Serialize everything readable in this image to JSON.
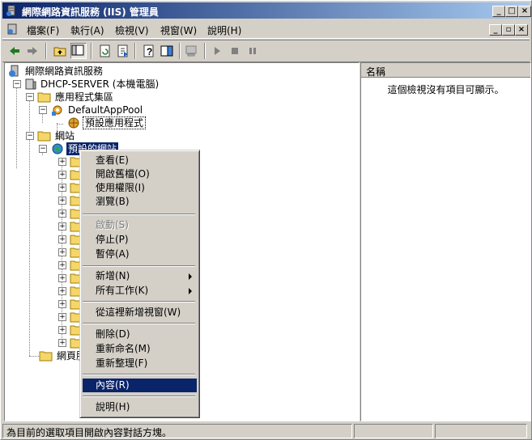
{
  "window": {
    "title": "網際網路資訊服務 (IIS) 管理員"
  },
  "menu": {
    "items": [
      "檔案(F)",
      "執行(A)",
      "檢視(V)",
      "視窗(W)",
      "說明(H)"
    ]
  },
  "tree": {
    "root": "網際網路資訊服務",
    "server": "DHCP-SERVER (本機電腦)",
    "app_pools": "應用程式集區",
    "default_pool": "DefaultAppPool",
    "default_app": "預設應用程式",
    "websites": "網站",
    "default_site": "預設的網站",
    "web_ext": "網頁服務延伸"
  },
  "rightpane": {
    "column_header": "名稱",
    "empty_message": "這個檢視沒有項目可顯示。"
  },
  "context_menu": {
    "items": [
      {
        "label": "查看(E)",
        "disabled": false
      },
      {
        "label": "開啟舊檔(O)",
        "disabled": false
      },
      {
        "label": "使用權限(I)",
        "disabled": false
      },
      {
        "label": "瀏覽(B)",
        "disabled": false
      },
      {
        "label": "啟動(S)",
        "disabled": true
      },
      {
        "label": "停止(P)",
        "disabled": false
      },
      {
        "label": "暫停(A)",
        "disabled": false
      },
      {
        "label": "新增(N)",
        "disabled": false,
        "submenu": true
      },
      {
        "label": "所有工作(K)",
        "disabled": false,
        "submenu": true
      },
      {
        "label": "從這裡新增視窗(W)",
        "disabled": false
      },
      {
        "label": "刪除(D)",
        "disabled": false
      },
      {
        "label": "重新命名(M)",
        "disabled": false
      },
      {
        "label": "重新整理(F)",
        "disabled": false
      },
      {
        "label": "內容(R)",
        "disabled": false,
        "highlighted": true
      },
      {
        "label": "說明(H)",
        "disabled": false
      }
    ]
  },
  "statusbar": {
    "text": "為目前的選取項目開啟內容對話方塊。"
  },
  "colors": {
    "titlebar": "#0a246a",
    "highlight": "#0a246a",
    "face": "#d4d0c8"
  }
}
